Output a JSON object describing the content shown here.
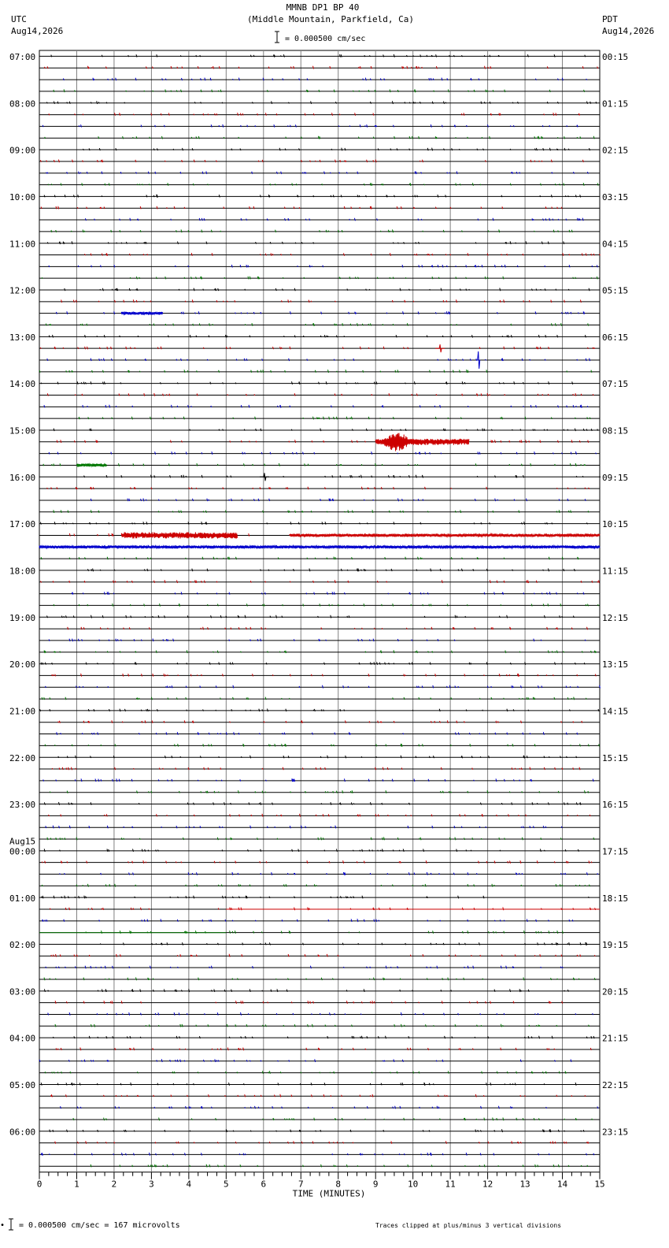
{
  "header": {
    "title": "MMNB DP1 BP 40",
    "subtitle": "(Middle Mountain, Parkfield, Ca)",
    "left_tz": "UTC",
    "left_date": "Aug14,2026",
    "right_tz": "PDT",
    "right_date": "Aug14,2026",
    "scale": "= 0.000500 cm/sec"
  },
  "footer": {
    "scale_note": "= 0.000500 cm/sec =     167 microvolts",
    "clip_note": "Traces clipped at plus/minus 3 vertical divisions"
  },
  "colors": {
    "trace_cycle": [
      "#000000",
      "#cc0000",
      "#0000cc",
      "#007700"
    ],
    "grid": "#000000"
  },
  "chart_data": {
    "type": "line",
    "title": "MMNB DP1 BP 40",
    "xlabel": "TIME (MINUTES)",
    "x_ticks": [
      "0",
      "1",
      "2",
      "3",
      "4",
      "5",
      "6",
      "7",
      "8",
      "9",
      "10",
      "11",
      "12",
      "13",
      "14",
      "15"
    ],
    "xlim": [
      0,
      15
    ],
    "rows_per_hour": 4,
    "left_hour_labels": [
      "07:00",
      "08:00",
      "09:00",
      "10:00",
      "11:00",
      "12:00",
      "13:00",
      "14:00",
      "15:00",
      "16:00",
      "17:00",
      "18:00",
      "19:00",
      "20:00",
      "21:00",
      "22:00",
      "23:00",
      "00:00",
      "01:00",
      "02:00",
      "03:00",
      "04:00",
      "05:00",
      "06:00"
    ],
    "date_change": {
      "hour_index": 17,
      "label": "Aug15"
    },
    "right_hour_labels": [
      "00:15",
      "01:15",
      "02:15",
      "03:15",
      "04:15",
      "05:15",
      "06:15",
      "07:15",
      "08:15",
      "09:15",
      "10:15",
      "11:15",
      "12:15",
      "13:15",
      "14:15",
      "15:15",
      "16:15",
      "17:15",
      "18:15",
      "19:15",
      "20:15",
      "21:15",
      "22:15",
      "23:15"
    ],
    "events": [
      {
        "row": 22,
        "start": 2.2,
        "end": 3.3,
        "amp": 2,
        "kind": "noise"
      },
      {
        "row": 25,
        "start": 10.6,
        "end": 10.85,
        "amp": 5,
        "kind": "spike"
      },
      {
        "row": 26,
        "start": 11.7,
        "end": 11.8,
        "amp": 11,
        "kind": "spike"
      },
      {
        "row": 33,
        "start": 9.0,
        "end": 11.5,
        "amp": 4,
        "kind": "noise"
      },
      {
        "row": 33,
        "start": 9.1,
        "end": 10.8,
        "amp": 12,
        "kind": "quake"
      },
      {
        "row": 35,
        "start": 1.0,
        "end": 1.8,
        "amp": 2,
        "kind": "noise"
      },
      {
        "row": 36,
        "start": 5.9,
        "end": 6.15,
        "amp": 5,
        "kind": "spike"
      },
      {
        "row": 41,
        "start": 2.2,
        "end": 5.3,
        "amp": 4,
        "kind": "noise"
      },
      {
        "row": 41,
        "start": 6.7,
        "end": 15,
        "amp": 2,
        "kind": "noise"
      },
      {
        "row": 42,
        "start": 0,
        "end": 15,
        "amp": 2,
        "kind": "noise"
      },
      {
        "row": 73,
        "start": 5.0,
        "end": 15,
        "amp": 1,
        "kind": "flat"
      },
      {
        "row": 75,
        "start": 0,
        "end": 5.0,
        "amp": 1,
        "kind": "flat"
      }
    ]
  }
}
